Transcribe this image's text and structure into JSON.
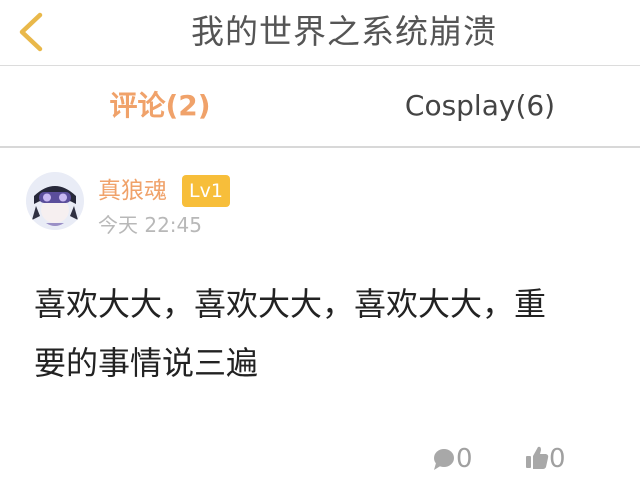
{
  "header": {
    "title": "我的世界之系统崩溃"
  },
  "tabs": [
    {
      "label": "评论(2)",
      "active": true
    },
    {
      "label": "Cosplay(6)",
      "active": false
    }
  ],
  "comment": {
    "username": "真狼魂",
    "level": "Lv1",
    "time": "今天 22:45",
    "lines": [
      "喜欢大大，喜欢大大，喜欢大大，重",
      "要的事情说三遍"
    ],
    "reply_count": "0",
    "like_count": "0"
  },
  "colors": {
    "accent": "#f0a26a",
    "badge": "#f7be3a",
    "back_arrow": "#e9b84a",
    "muted": "#a0a0a0"
  }
}
